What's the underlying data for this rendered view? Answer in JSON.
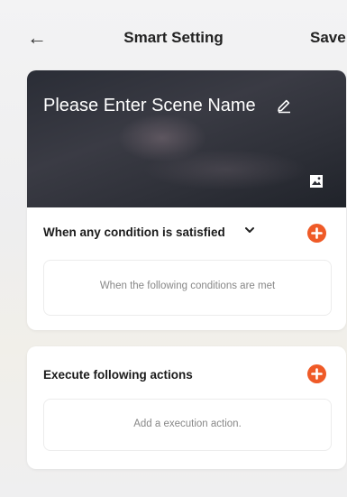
{
  "header": {
    "back_icon": "arrow-left-icon",
    "title": "Smart Setting",
    "save_label": "Save"
  },
  "scene": {
    "name_placeholder": "Please Enter Scene Name",
    "edit_icon": "pencil-icon",
    "image_icon": "image-icon"
  },
  "conditions": {
    "label": "When any condition is satisfied",
    "dropdown_icon": "chevron-down-icon",
    "add_icon": "plus-icon",
    "empty_text": "When the following conditions are met"
  },
  "actions": {
    "label": "Execute following actions",
    "add_icon": "plus-icon",
    "empty_text": "Add a execution action."
  },
  "colors": {
    "accent": "#ef5a27",
    "background": "#efeff0",
    "card": "#ffffff"
  }
}
